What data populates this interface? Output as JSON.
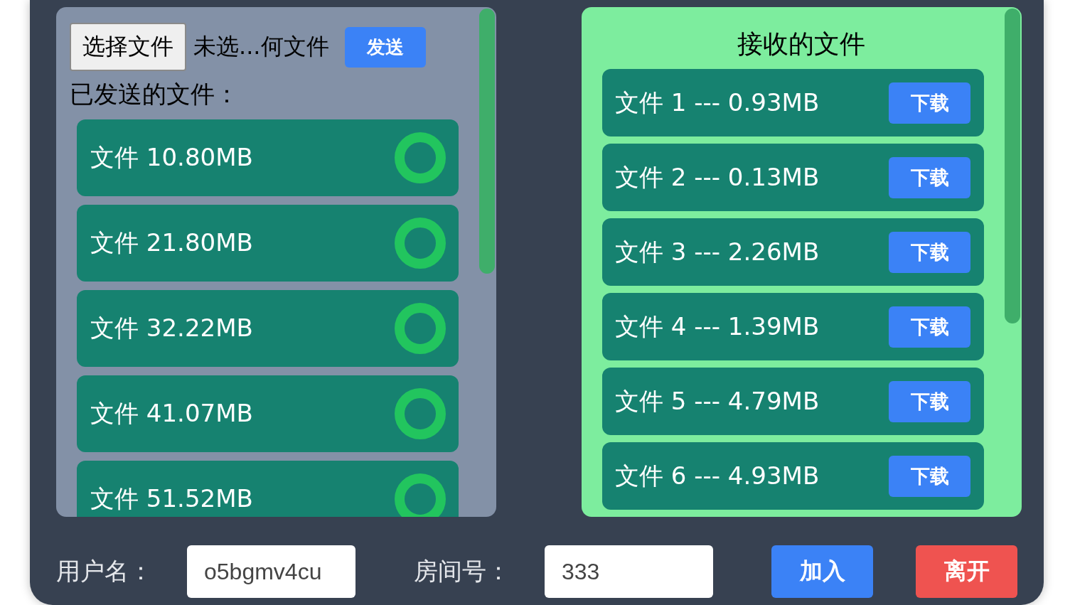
{
  "file_picker": {
    "button": "选择文件",
    "filename": "未选...何文件"
  },
  "send_button": "发送",
  "sent_title": "已发送的文件：",
  "sent_files": [
    {
      "label": "文件 10.80MB"
    },
    {
      "label": "文件 21.80MB"
    },
    {
      "label": "文件 32.22MB"
    },
    {
      "label": "文件 41.07MB"
    },
    {
      "label": "文件 51.52MB"
    }
  ],
  "received_title": "接收的文件",
  "received_files": [
    {
      "label": "文件 1 --- 0.93MB",
      "button": "下载"
    },
    {
      "label": "文件 2 --- 0.13MB",
      "button": "下载"
    },
    {
      "label": "文件 3 --- 2.26MB",
      "button": "下载"
    },
    {
      "label": "文件 4 --- 1.39MB",
      "button": "下载"
    },
    {
      "label": "文件 5 --- 4.79MB",
      "button": "下载"
    },
    {
      "label": "文件 6 --- 4.93MB",
      "button": "下载"
    }
  ],
  "user_label": "用户名：",
  "username": "o5bgmv4cu",
  "room_label": "房间号：",
  "room": "333",
  "join_button": "加入",
  "leave_button": "离开"
}
